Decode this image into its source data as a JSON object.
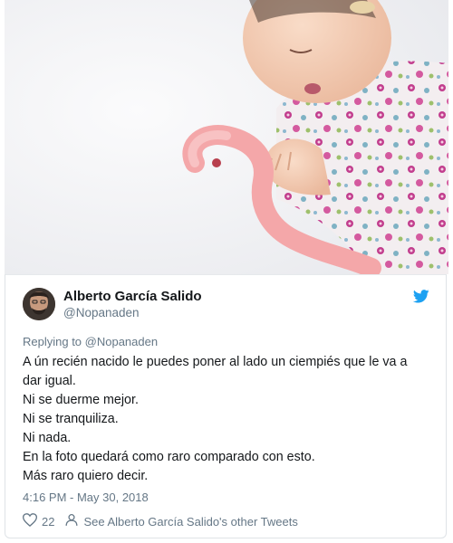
{
  "photo": {
    "alt_subject": "baby-sleeping-with-pink-toy"
  },
  "author": {
    "name": "Alberto García Salido",
    "handle": "@Nopanaden"
  },
  "reply": {
    "text": "Replying to @Nopanaden"
  },
  "tweet": {
    "lines": [
      "A ún recién nacido le puedes poner al lado un ciempiés que le va a",
      "dar igual.",
      "Ni se duerme mejor.",
      "Ni se tranquiliza.",
      "Ni nada.",
      "En la foto quedará como raro comparado con esto.",
      "Más raro quiero decir."
    ]
  },
  "timestamp": "4:16 PM - May 30, 2018",
  "actions": {
    "like_count": "22",
    "see_other_label": "See Alberto García Salido's other Tweets"
  },
  "colors": {
    "twitter_blue": "#1da1f2",
    "text_primary": "#14171a",
    "text_secondary": "#657786",
    "toy_pink": "#f4a7a9"
  }
}
